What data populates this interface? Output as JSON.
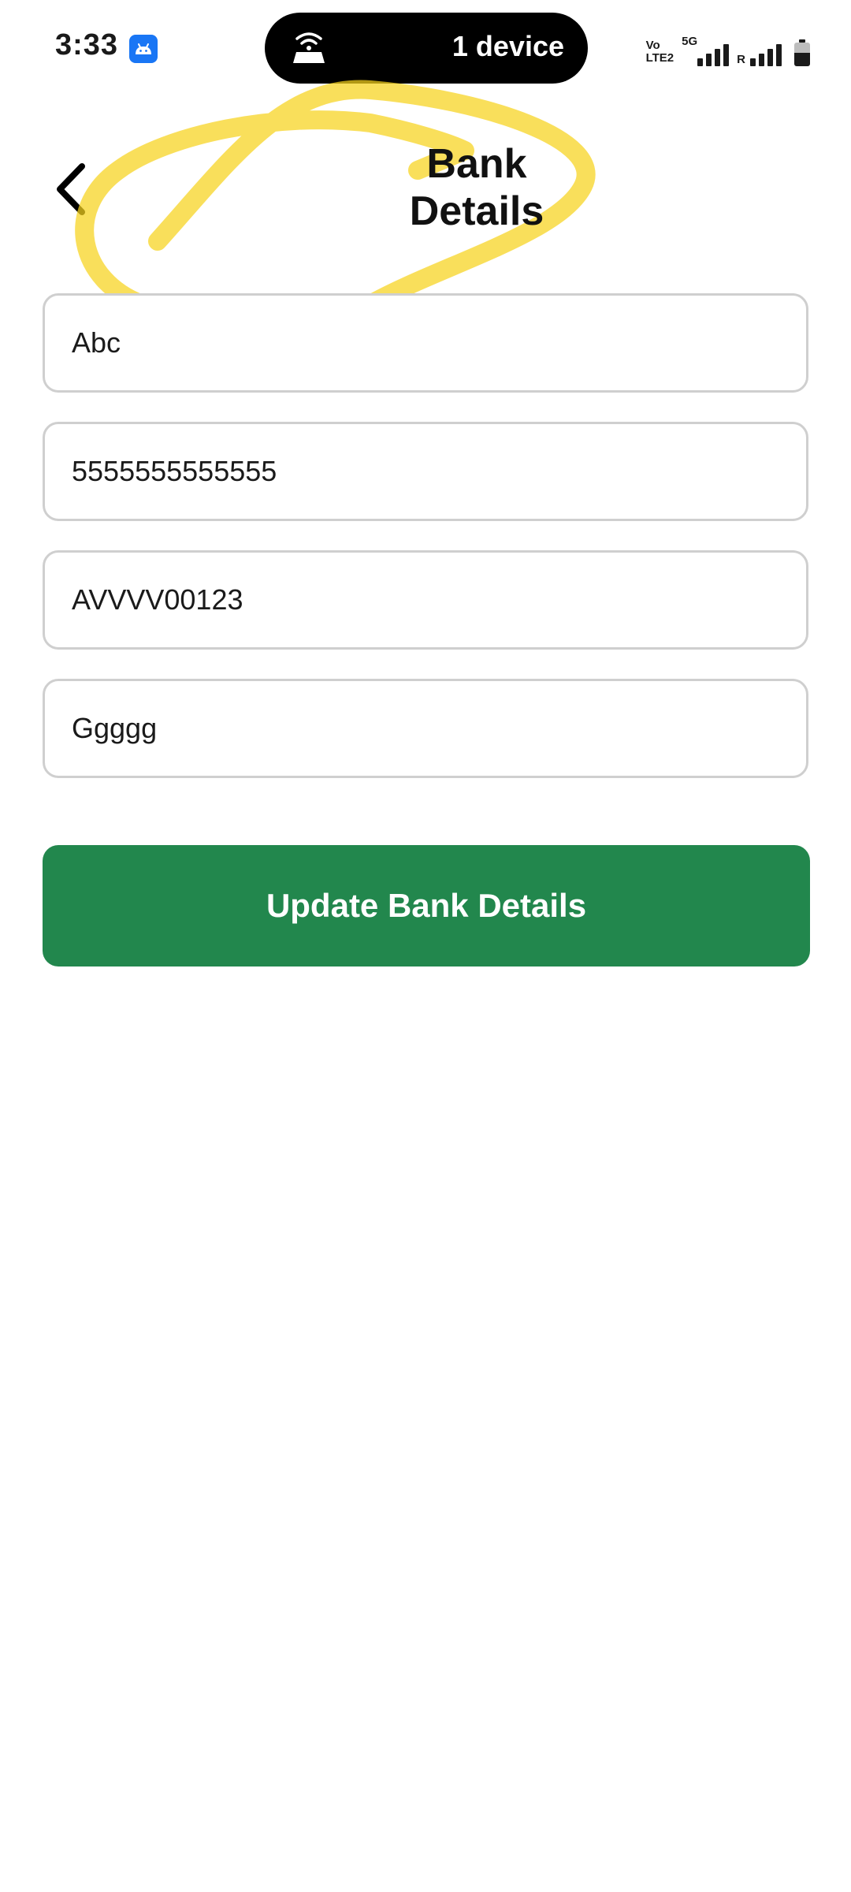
{
  "status_bar": {
    "time": "3:33",
    "app_icon": "android-icon",
    "hotspot_icon": "hotspot-icon",
    "hotspot_text": "1 device",
    "volte_line1": "Vo",
    "volte_line2": "LTE2",
    "network_type": "5G",
    "roaming_label": "R",
    "battery_level": 0.55
  },
  "header": {
    "back_icon": "chevron-left-icon",
    "title": "Bank\nDetails",
    "highlight_color": "#f7d21c"
  },
  "form": {
    "fields": [
      {
        "value": "Abc"
      },
      {
        "value": "5555555555555"
      },
      {
        "value": "AVVVV00123"
      },
      {
        "value": "Ggggg"
      }
    ],
    "submit_label": "Update Bank Details",
    "submit_color": "#22874d"
  }
}
